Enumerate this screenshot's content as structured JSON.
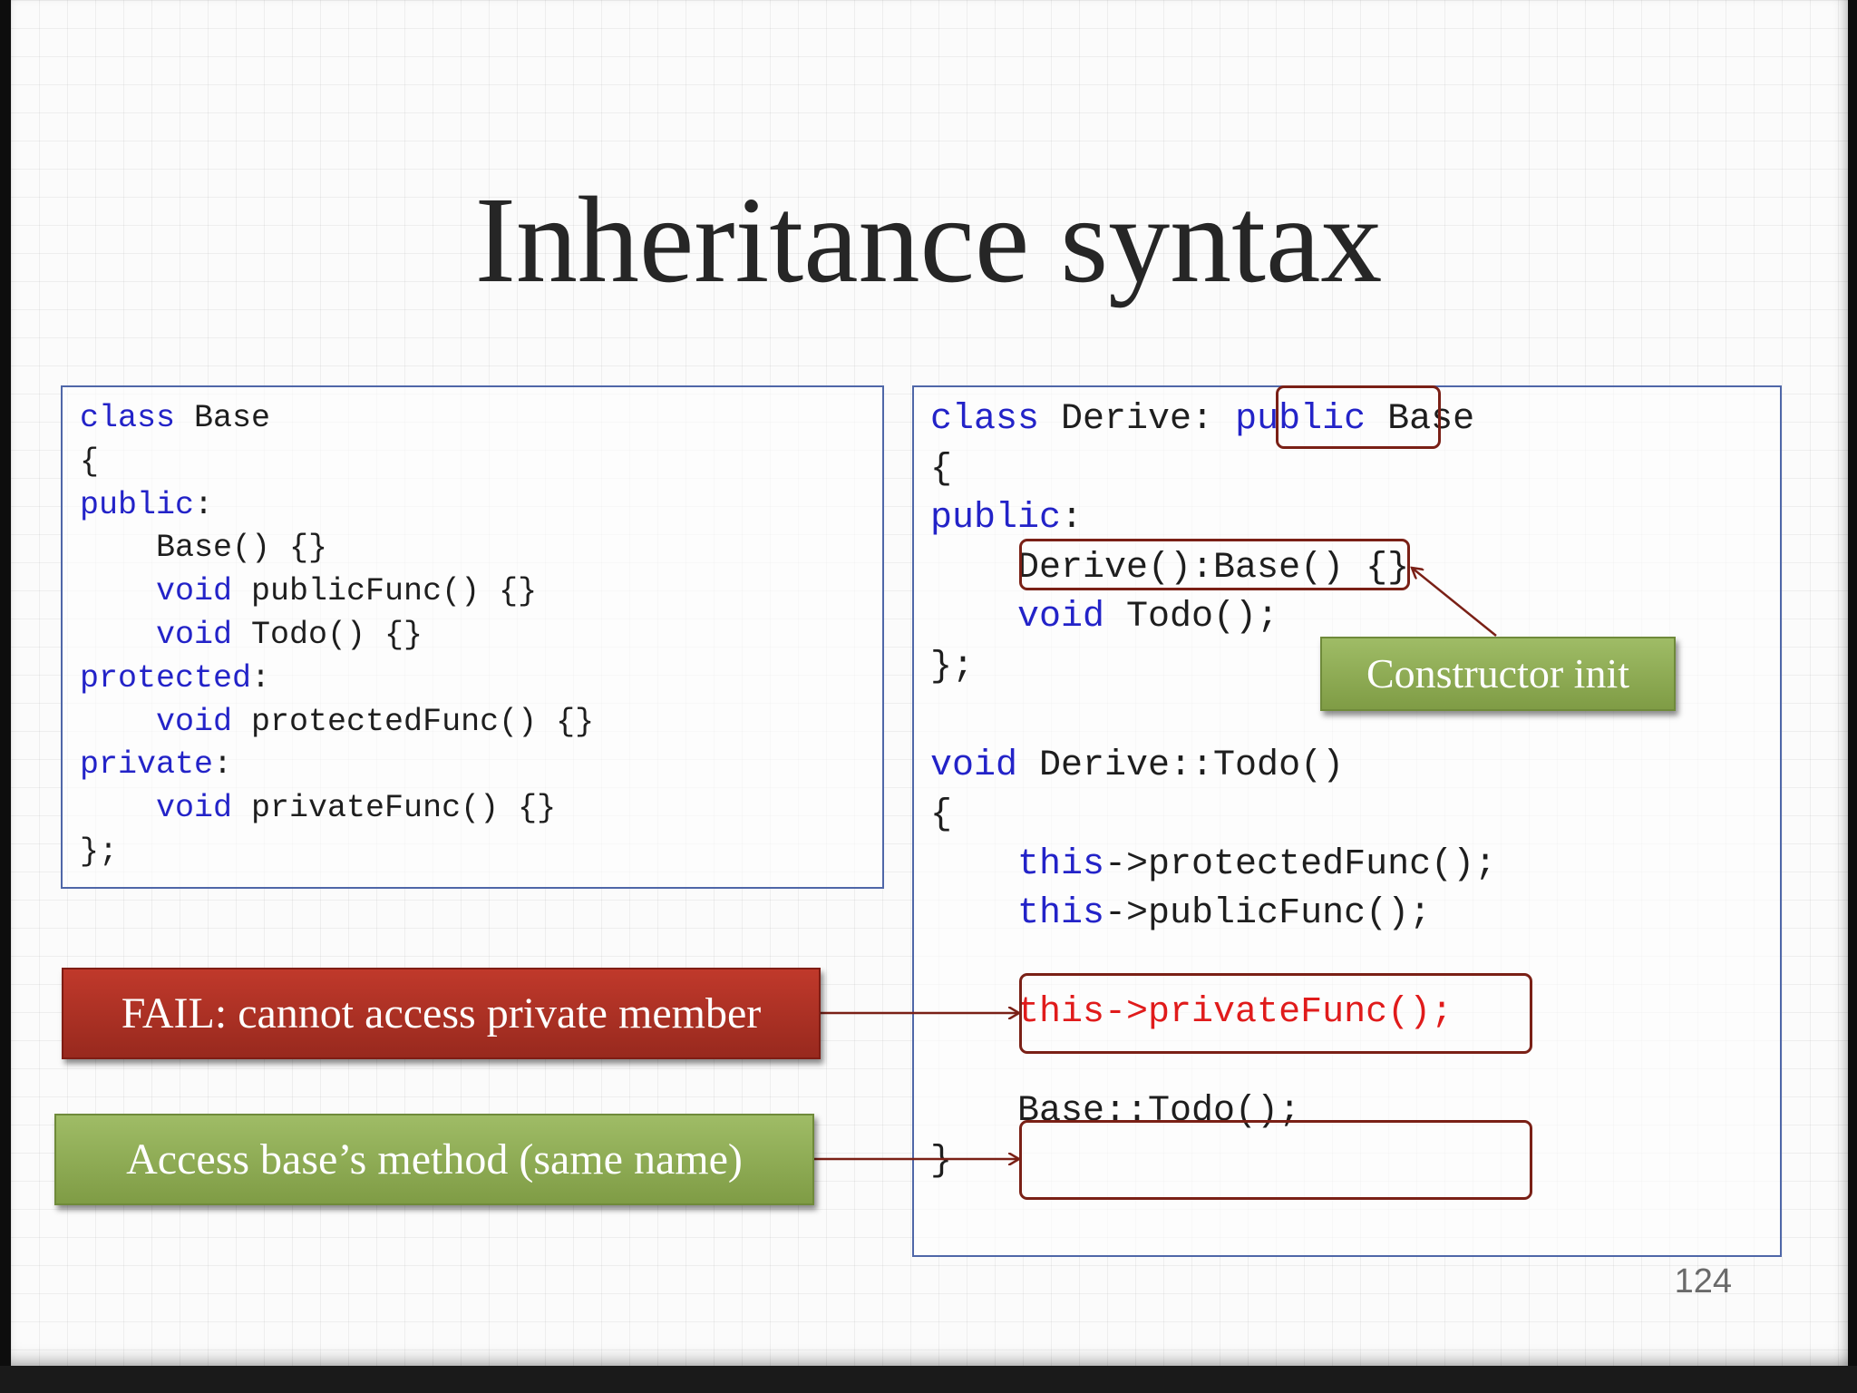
{
  "slide": {
    "title": "Inheritance syntax",
    "page_number": "124"
  },
  "base_class_code": [
    [
      {
        "t": "class",
        "k": "kw"
      },
      {
        "t": " Base"
      }
    ],
    [
      {
        "t": "{"
      }
    ],
    [
      {
        "t": "public",
        "k": "kw"
      },
      {
        "t": ":"
      }
    ],
    [
      {
        "t": "    Base() {}"
      }
    ],
    [
      {
        "t": "    "
      },
      {
        "t": "void",
        "k": "kw"
      },
      {
        "t": " publicFunc() {}"
      }
    ],
    [
      {
        "t": "    "
      },
      {
        "t": "void",
        "k": "kw"
      },
      {
        "t": " Todo() {}"
      }
    ],
    [
      {
        "t": "protected",
        "k": "kw"
      },
      {
        "t": ":"
      }
    ],
    [
      {
        "t": "    "
      },
      {
        "t": "void",
        "k": "kw"
      },
      {
        "t": " protectedFunc() {}"
      }
    ],
    [
      {
        "t": "private",
        "k": "kw"
      },
      {
        "t": ":"
      }
    ],
    [
      {
        "t": "    "
      },
      {
        "t": "void",
        "k": "kw"
      },
      {
        "t": " privateFunc() {}"
      }
    ],
    [
      {
        "t": "};"
      }
    ]
  ],
  "derive_class_code": [
    [
      {
        "t": "class",
        "k": "kw"
      },
      {
        "t": " Derive: "
      },
      {
        "t": "public",
        "k": "kw"
      },
      {
        "t": " Base"
      }
    ],
    [
      {
        "t": "{"
      }
    ],
    [
      {
        "t": "public",
        "k": "kw"
      },
      {
        "t": ":"
      }
    ],
    [
      {
        "t": "    Derive():Base() {}"
      }
    ],
    [
      {
        "t": "    "
      },
      {
        "t": "void",
        "k": "kw"
      },
      {
        "t": " Todo();"
      }
    ],
    [
      {
        "t": "};"
      }
    ],
    [
      {
        "t": ""
      }
    ],
    [
      {
        "t": "void",
        "k": "kw"
      },
      {
        "t": " Derive::Todo()"
      }
    ],
    [
      {
        "t": "{"
      }
    ],
    [
      {
        "t": "    "
      },
      {
        "t": "this",
        "k": "kw"
      },
      {
        "t": "->protectedFunc();"
      }
    ],
    [
      {
        "t": "    "
      },
      {
        "t": "this",
        "k": "kw"
      },
      {
        "t": "->publicFunc();"
      }
    ],
    [
      {
        "t": ""
      }
    ],
    [
      {
        "t": "    "
      },
      {
        "t": "this->privateFunc();",
        "k": "err"
      }
    ],
    [
      {
        "t": ""
      }
    ],
    [
      {
        "t": "    Base::Todo();"
      }
    ],
    [
      {
        "t": "}"
      }
    ]
  ],
  "callouts": {
    "constructor_init": "Constructor init",
    "fail_private": "FAIL: cannot access private member",
    "access_base_method": "Access base’s method (same name)"
  },
  "colors": {
    "keyword": "#2323c8",
    "error_code": "#e01b1b",
    "highlight_border": "#7a2016",
    "callout_green": "#8fac55",
    "callout_red": "#b03426",
    "code_box_border": "#4f67a8"
  }
}
